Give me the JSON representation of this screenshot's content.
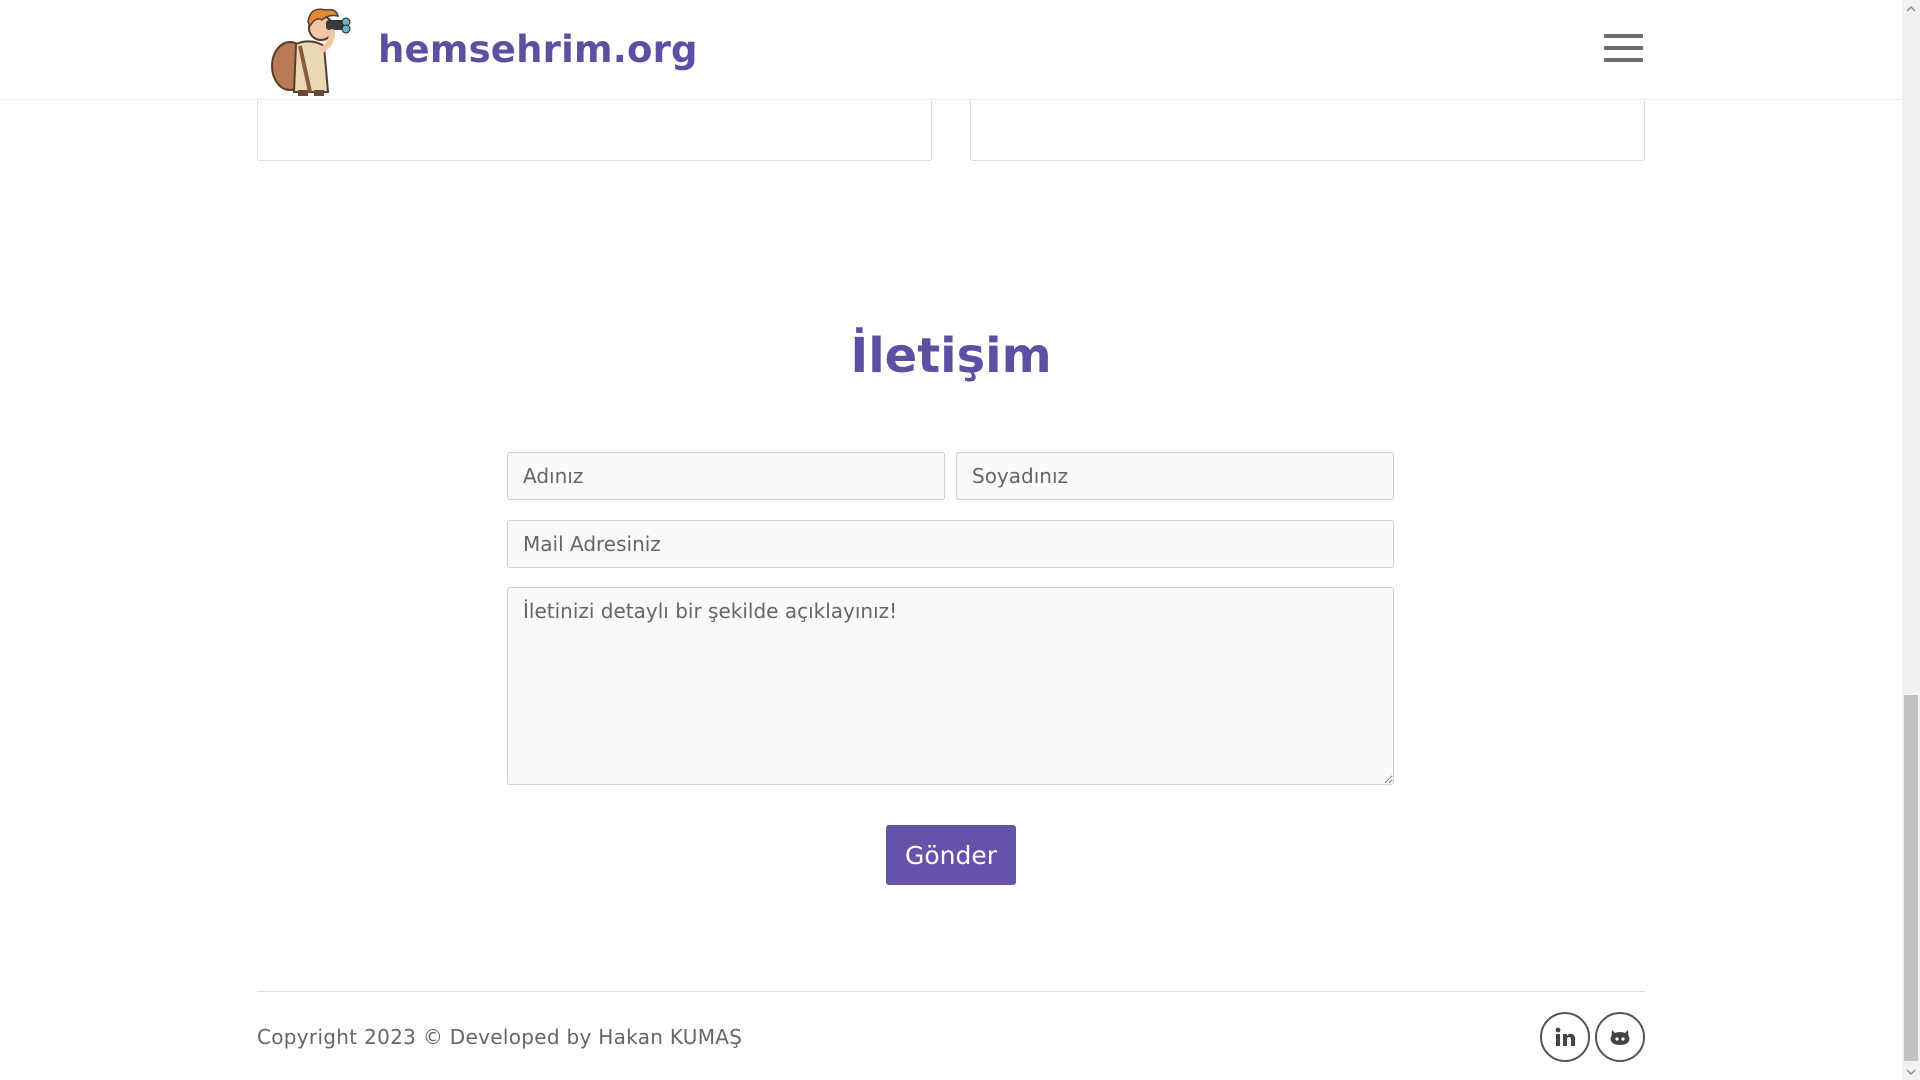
{
  "header": {
    "brand": "hemsehrim.org",
    "logo_icon": "binoculars-traveler-logo",
    "menu_icon": "hamburger-menu-icon"
  },
  "contact": {
    "title": "İletişim",
    "first_name_placeholder": "Adınız",
    "last_name_placeholder": "Soyadınız",
    "email_placeholder": "Mail Adresiniz",
    "message_placeholder": "İletinizi detaylı bir şekilde açıklayınız!",
    "submit_label": "Gönder"
  },
  "footer": {
    "copyright": "Copyright 2023 © Developed by Hakan KUMAŞ",
    "social": [
      {
        "icon": "linkedin-icon"
      },
      {
        "icon": "github-icon"
      }
    ]
  },
  "colors": {
    "brand": "#5f4fa3",
    "button": "#6652a8",
    "text": "#666666"
  }
}
